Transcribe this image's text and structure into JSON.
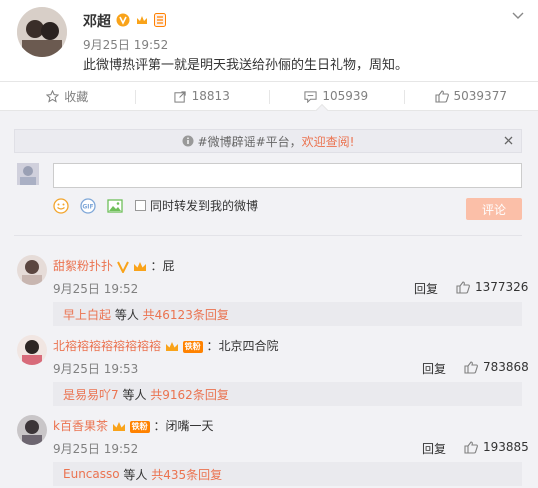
{
  "post": {
    "author": "邓超",
    "time": "9月25日 19:52",
    "text": "此微博热评第一就是明天我送给孙俪的生日礼物，周知。"
  },
  "actions": {
    "favorite": "收藏",
    "repost": "18813",
    "comment": "105939",
    "like": "5039377"
  },
  "notice": {
    "text": "#微博辟谣#平台，",
    "link": "欢迎查阅!"
  },
  "composer": {
    "repost_label": "同时转发到我的微博",
    "submit": "评论"
  },
  "comments": [
    {
      "user": "甜絮粉扑扑",
      "text": "：屁",
      "time": "9月25日 19:52",
      "reply": "回复",
      "likes": "1377326",
      "sub_user": "早上白起",
      "sub_mid": " 等人 ",
      "sub_count": "共46123条回复"
    },
    {
      "user": "北褣褣褣褣褣褣褣褣",
      "badge": "铁粉",
      "text": "：北京四合院",
      "time": "9月25日 19:53",
      "reply": "回复",
      "likes": "783868",
      "sub_user": "是易易吖7",
      "sub_mid": " 等人 ",
      "sub_count": "共9162条回复"
    },
    {
      "user": "k百香果茶",
      "badge": "铁粉",
      "text": "：闭嘴一天",
      "time": "9月25日 19:52",
      "reply": "回复",
      "likes": "193885",
      "sub_user": "Euncasso",
      "sub_mid": " 等人 ",
      "sub_count": "共435条回复"
    }
  ],
  "colors": {
    "accent": "#eb7350",
    "submit": "#fbbfa8",
    "vip": "#ff8200"
  }
}
